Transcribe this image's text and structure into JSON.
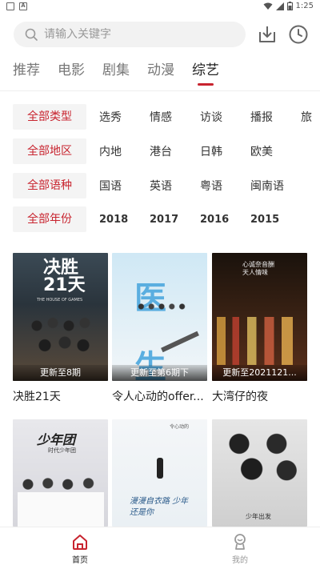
{
  "status_bar": {
    "time": "1:25"
  },
  "search": {
    "placeholder": "请输入关键字"
  },
  "tabs": [
    {
      "label": "推荐",
      "active": false
    },
    {
      "label": "电影",
      "active": false
    },
    {
      "label": "剧集",
      "active": false
    },
    {
      "label": "动漫",
      "active": false
    },
    {
      "label": "综艺",
      "active": true
    }
  ],
  "filters": {
    "type": {
      "chip": "全部类型",
      "items": [
        "选秀",
        "情感",
        "访谈",
        "播报",
        "旅"
      ]
    },
    "region": {
      "chip": "全部地区",
      "items": [
        "内地",
        "港台",
        "日韩",
        "欧美"
      ]
    },
    "lang": {
      "chip": "全部语种",
      "items": [
        "国语",
        "英语",
        "粤语",
        "闽南语"
      ]
    },
    "year": {
      "chip": "全部年份",
      "items": [
        "2018",
        "2017",
        "2016",
        "2015"
      ]
    }
  },
  "cards": [
    {
      "title": "决胜21天",
      "caption": "更新至8期",
      "poster_text": "决胜 21天",
      "poster_sub": "THE HOUSE OF GAMES"
    },
    {
      "title": "令人心动的offer...",
      "caption": "更新至第6期下",
      "poster_text": "医 生"
    },
    {
      "title": "大湾仔的夜",
      "caption": "更新至2021121...",
      "poster_text": "心诚奈音酬天人情味"
    },
    {
      "title": "",
      "caption": "",
      "poster_text": "少年团",
      "poster_sub": "时代少年团"
    },
    {
      "title": "",
      "caption": "",
      "poster_text": "漫漫自衣路 少年还是你",
      "poster_sub": "令心动的"
    },
    {
      "title": "",
      "caption": "",
      "poster_text": "少年出发"
    }
  ],
  "bottom_nav": [
    {
      "label": "首页",
      "icon": "home-icon",
      "active": true
    },
    {
      "label": "我的",
      "icon": "profile-icon",
      "active": false
    }
  ],
  "colors": {
    "accent": "#c8242f",
    "chip_bg": "#f4f4f4",
    "search_bg": "#f2f2f2"
  }
}
